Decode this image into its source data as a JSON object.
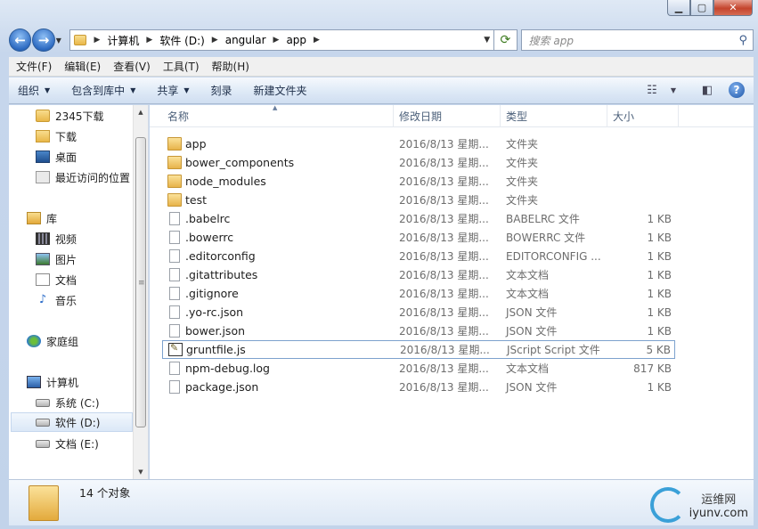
{
  "address": {
    "crumbs": [
      "计算机",
      "软件 (D:)",
      "angular",
      "app"
    ],
    "search_placeholder": "搜索 app"
  },
  "menu": [
    "文件(F)",
    "编辑(E)",
    "查看(V)",
    "工具(T)",
    "帮助(H)"
  ],
  "commands": [
    {
      "label": "组织",
      "dropdown": true
    },
    {
      "label": "包含到库中",
      "dropdown": true
    },
    {
      "label": "共享",
      "dropdown": true
    },
    {
      "label": "刻录",
      "dropdown": false
    },
    {
      "label": "新建文件夹",
      "dropdown": false
    }
  ],
  "nav": {
    "favorites": [
      {
        "label": "2345下载",
        "icon": "folder-icon"
      },
      {
        "label": "下载",
        "icon": "download-folder-icon"
      },
      {
        "label": "桌面",
        "icon": "desktop-icon"
      },
      {
        "label": "最近访问的位置",
        "icon": "recent-places-icon"
      }
    ],
    "library": {
      "label": "库",
      "items": [
        {
          "label": "视频",
          "icon": "video-icon"
        },
        {
          "label": "图片",
          "icon": "picture-icon"
        },
        {
          "label": "文档",
          "icon": "document-icon"
        },
        {
          "label": "音乐",
          "icon": "music-icon"
        }
      ]
    },
    "homegroup": "家庭组",
    "computer": {
      "label": "计算机",
      "drives": [
        {
          "label": "系统 (C:)",
          "selected": false
        },
        {
          "label": "软件 (D:)",
          "selected": true
        },
        {
          "label": "文档 (E:)",
          "selected": false
        }
      ]
    }
  },
  "columns": {
    "name": "名称",
    "date": "修改日期",
    "type": "类型",
    "size": "大小"
  },
  "files": [
    {
      "name": "app",
      "date": "2016/8/13 星期...",
      "type": "文件夹",
      "size": "",
      "kind": "folder"
    },
    {
      "name": "bower_components",
      "date": "2016/8/13 星期...",
      "type": "文件夹",
      "size": "",
      "kind": "folder"
    },
    {
      "name": "node_modules",
      "date": "2016/8/13 星期...",
      "type": "文件夹",
      "size": "",
      "kind": "folder"
    },
    {
      "name": "test",
      "date": "2016/8/13 星期...",
      "type": "文件夹",
      "size": "",
      "kind": "folder"
    },
    {
      "name": ".babelrc",
      "date": "2016/8/13 星期...",
      "type": "BABELRC 文件",
      "size": "1 KB",
      "kind": "file"
    },
    {
      "name": ".bowerrc",
      "date": "2016/8/13 星期...",
      "type": "BOWERRC 文件",
      "size": "1 KB",
      "kind": "file"
    },
    {
      "name": ".editorconfig",
      "date": "2016/8/13 星期...",
      "type": "EDITORCONFIG ...",
      "size": "1 KB",
      "kind": "file"
    },
    {
      "name": ".gitattributes",
      "date": "2016/8/13 星期...",
      "type": "文本文档",
      "size": "1 KB",
      "kind": "file"
    },
    {
      "name": ".gitignore",
      "date": "2016/8/13 星期...",
      "type": "文本文档",
      "size": "1 KB",
      "kind": "file"
    },
    {
      "name": ".yo-rc.json",
      "date": "2016/8/13 星期...",
      "type": "JSON 文件",
      "size": "1 KB",
      "kind": "file"
    },
    {
      "name": "bower.json",
      "date": "2016/8/13 星期...",
      "type": "JSON 文件",
      "size": "1 KB",
      "kind": "file"
    },
    {
      "name": "gruntfile.js",
      "date": "2016/8/13 星期...",
      "type": "JScript Script 文件",
      "size": "5 KB",
      "kind": "script",
      "selected": true
    },
    {
      "name": "npm-debug.log",
      "date": "2016/8/13 星期...",
      "type": "文本文档",
      "size": "817 KB",
      "kind": "file"
    },
    {
      "name": "package.json",
      "date": "2016/8/13 星期...",
      "type": "JSON 文件",
      "size": "1 KB",
      "kind": "file"
    }
  ],
  "status": {
    "count": "14 个对象"
  },
  "watermark": {
    "line1": "运维网",
    "line2": "iyunv.com"
  }
}
